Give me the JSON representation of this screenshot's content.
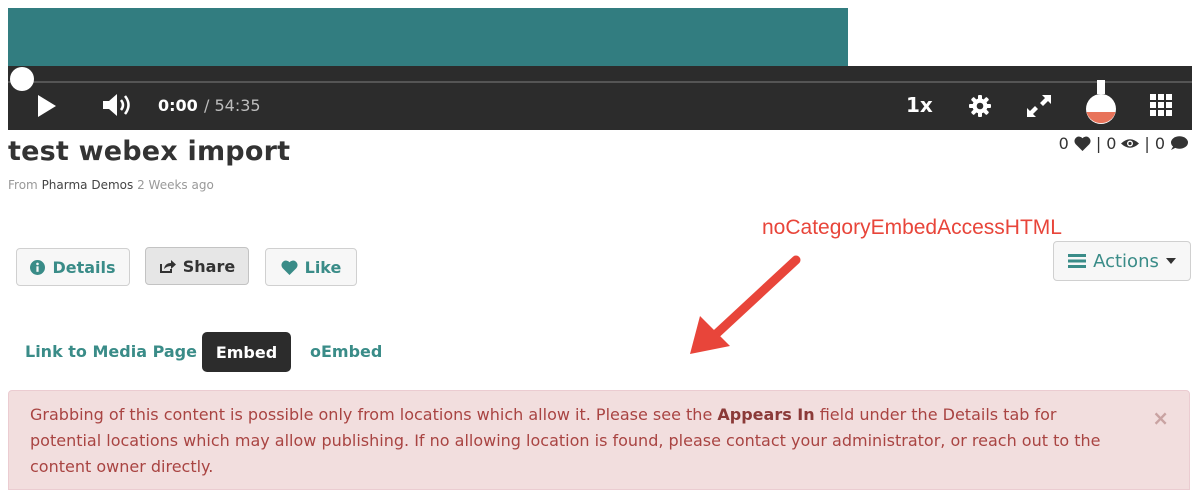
{
  "player": {
    "time_current": "0:00",
    "time_total": "/ 54:35",
    "speed": "1x",
    "progress": 0
  },
  "media": {
    "title": "test webex import",
    "byline_prefix": "From",
    "owner": "Pharma Demos",
    "age": "2 Weeks ago",
    "likes": "0",
    "views": "0",
    "comments": "0",
    "separator": "|"
  },
  "annotation": "noCategoryEmbedAccessHTML",
  "buttons": {
    "details": "Details",
    "share": "Share",
    "like": "Like",
    "actions": "Actions"
  },
  "embed_tabs": [
    "Link to Media Page",
    "Embed",
    "oEmbed"
  ],
  "alert": {
    "part1": "Grabbing of this content is possible only from locations which allow it. Please see the ",
    "bold": "Appears In",
    "part2": " field under the Details tab for potential locations which may allow publishing. If no allowing location is found, please contact your administrator, or reach out to the content owner directly.",
    "close": "×"
  },
  "colors": {
    "teal": "#327d80",
    "player_bg": "#2c2c2c",
    "link": "#3a8c88",
    "annotation": "#e8453a",
    "alert_bg": "#f2dede",
    "alert_text": "#a94442"
  }
}
